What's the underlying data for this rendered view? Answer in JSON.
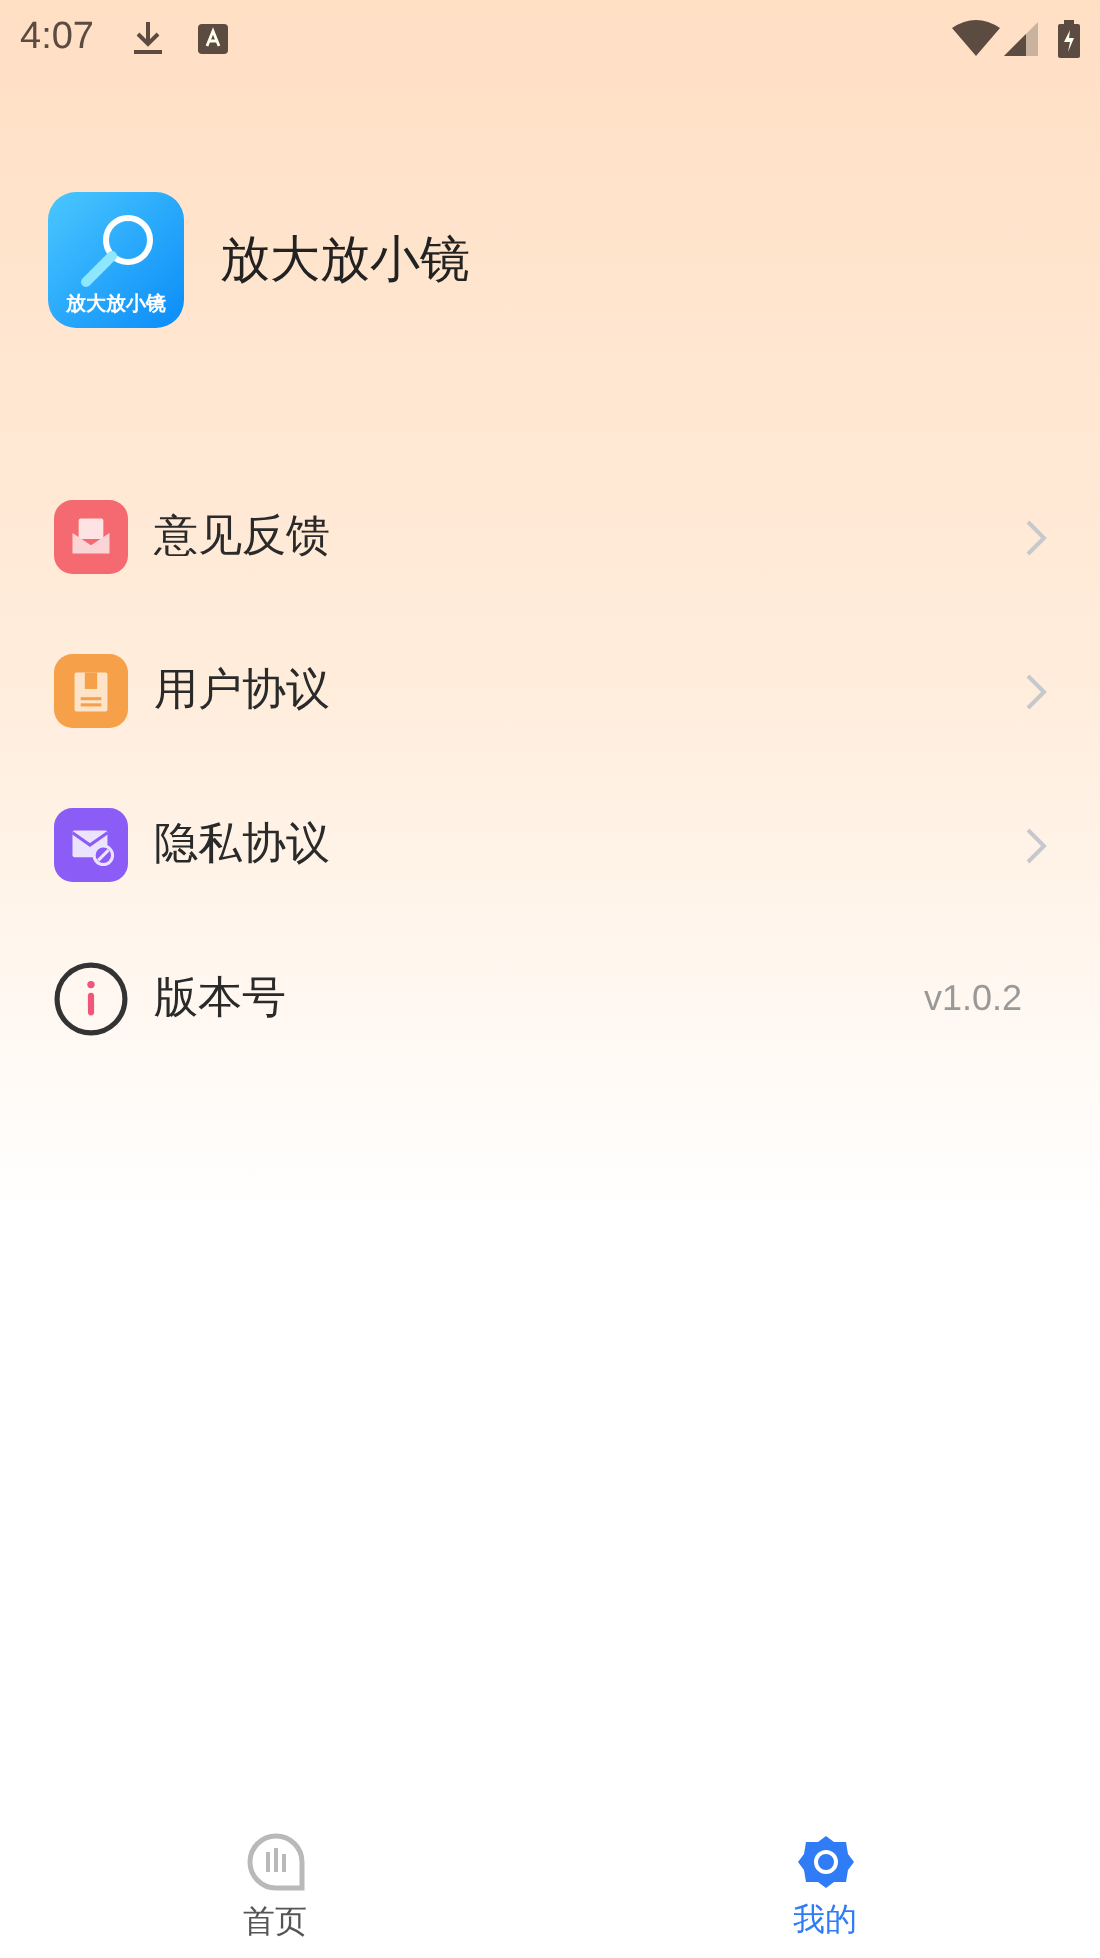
{
  "status_bar": {
    "time": "4:07"
  },
  "app": {
    "name": "放大放小镜",
    "icon_label": "放大放小镜"
  },
  "menu": [
    {
      "label": "意见反馈",
      "kind": "link"
    },
    {
      "label": "用户协议",
      "kind": "link"
    },
    {
      "label": "隐私协议",
      "kind": "link"
    },
    {
      "label": "版本号",
      "kind": "info",
      "value": "v1.0.2"
    }
  ],
  "tabs": [
    {
      "label": "首页",
      "selected": false
    },
    {
      "label": "我的",
      "selected": true
    }
  ]
}
